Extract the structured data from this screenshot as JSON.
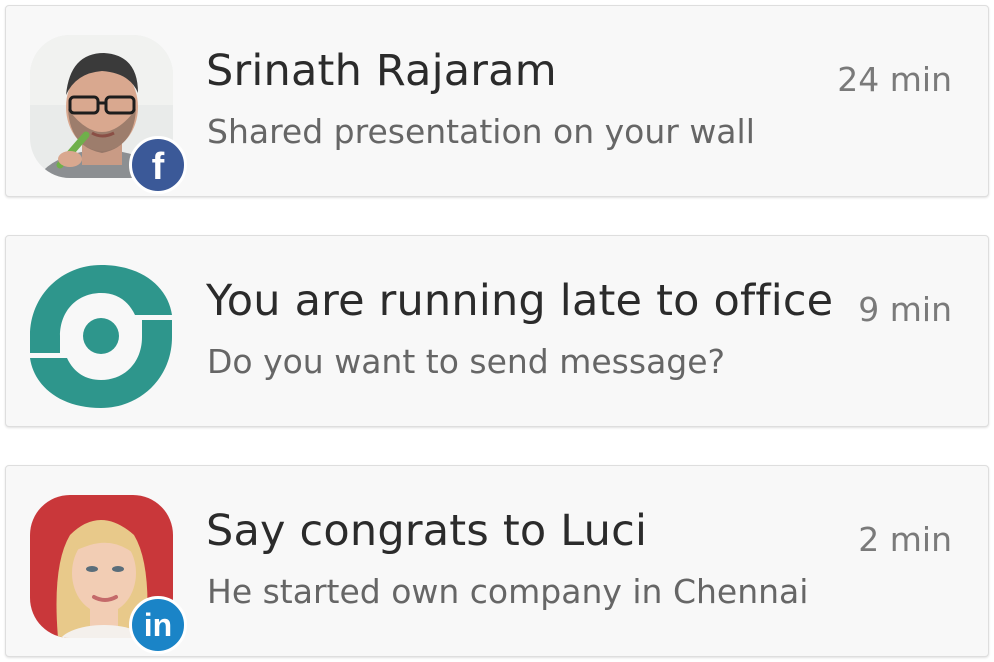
{
  "notifications": [
    {
      "title": "Srinath Rajaram",
      "subtitle": "Shared presentation on your wall",
      "time": "24 min",
      "avatar": "man-with-glasses-photo",
      "badge": {
        "icon": "facebook-icon",
        "glyph": "f",
        "color": "#3b5998"
      }
    },
    {
      "title": "You are running late to office",
      "subtitle": "Do you want to send message?",
      "time": "9 min",
      "avatar": "app-logo-icon",
      "logo_color": "#2e968c"
    },
    {
      "title": "Say congrats to Luci",
      "subtitle": "He started own company in Chennai",
      "time": "2 min",
      "avatar": "woman-blonde-photo",
      "badge": {
        "icon": "linkedin-icon",
        "glyph": "in",
        "color": "#1a84c7"
      }
    }
  ]
}
